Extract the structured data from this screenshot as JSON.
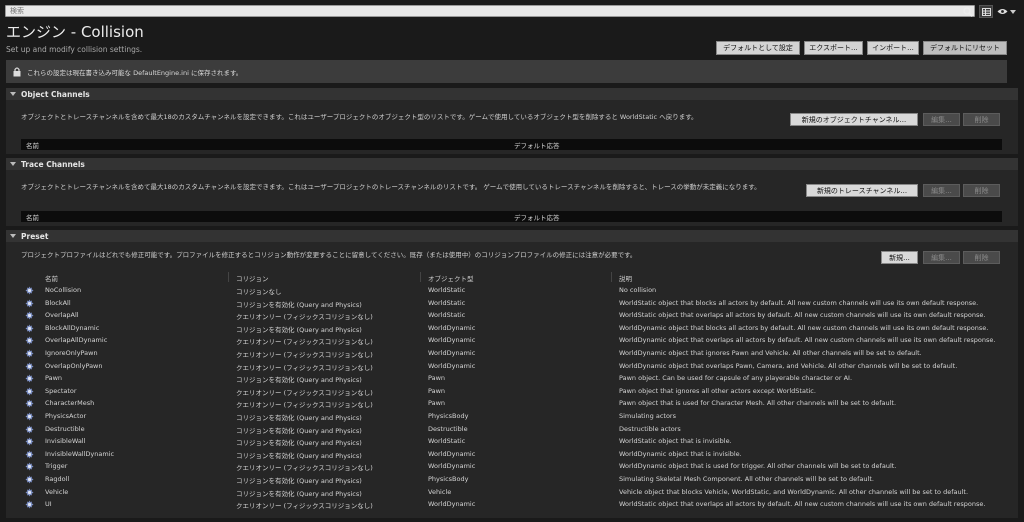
{
  "search": {
    "placeholder": "検索"
  },
  "header": {
    "title": "エンジン - Collision",
    "subtitle": "Set up and modify collision settings.",
    "buttons": {
      "set_default": "デフォルトとして設定",
      "export": "エクスポート...",
      "import": "インポート...",
      "reset": "デフォルトにリセット"
    }
  },
  "notice": {
    "text": "これらの設定は現在書き込み可能な DefaultEngine.ini に保存されます。"
  },
  "object_channels": {
    "title": "Object Channels",
    "description": "オブジェクトとトレースチャンネルを含めて最大18のカスタムチャンネルを設定できます。これはユーザープロジェクトのオブジェクト型のリストです。ゲームで使用しているオブジェクト型を削除すると WorldStatic へ戻ります。",
    "new_button": "新規のオブジェクトチャンネル...",
    "edit_button": "編集...",
    "delete_button": "削除",
    "col_name": "名前",
    "col_default": "デフォルト応答"
  },
  "trace_channels": {
    "title": "Trace Channels",
    "description": "オブジェクトとトレースチャンネルを含めて最大18のカスタムチャンネルを設定できます。これはユーザープロジェクトのトレースチャンネルのリストです。 ゲームで使用しているトレースチャンネルを削除すると、トレースの挙動が未定義になります。",
    "new_button": "新規のトレースチャンネル...",
    "edit_button": "編集...",
    "delete_button": "削除",
    "col_name": "名前",
    "col_default": "デフォルト応答"
  },
  "preset": {
    "title": "Preset",
    "description": "プロジェクトプロファイルはどれでも修正可能です。プロファイルを修正するとコリジョン動作が変更することに留意してください。既存（または使用中）のコリジョンプロファイルの修正には注意が必要です。",
    "new_button": "新規...",
    "edit_button": "編集...",
    "delete_button": "削除",
    "columns": {
      "name": "名前",
      "collision": "コリジョン",
      "object_type": "オブジェクト型",
      "description": "説明"
    },
    "rows": [
      {
        "name": "NoCollision",
        "collision": "コリジョンなし",
        "object_type": "WorldStatic",
        "description": "No collision"
      },
      {
        "name": "BlockAll",
        "collision": "コリジョンを有効化 (Query and Physics)",
        "object_type": "WorldStatic",
        "description": "WorldStatic object that blocks all actors by default. All new custom channels will use its own default response."
      },
      {
        "name": "OverlapAll",
        "collision": "クエリオンリー (フィジックスコリジョンなし)",
        "object_type": "WorldStatic",
        "description": "WorldStatic object that overlaps all actors by default. All new custom channels will use its own default response."
      },
      {
        "name": "BlockAllDynamic",
        "collision": "コリジョンを有効化 (Query and Physics)",
        "object_type": "WorldDynamic",
        "description": "WorldDynamic object that blocks all actors by default. All new custom channels will use its own default response."
      },
      {
        "name": "OverlapAllDynamic",
        "collision": "クエリオンリー (フィジックスコリジョンなし)",
        "object_type": "WorldDynamic",
        "description": "WorldDynamic object that overlaps all actors by default. All new custom channels will use its own default response."
      },
      {
        "name": "IgnoreOnlyPawn",
        "collision": "クエリオンリー (フィジックスコリジョンなし)",
        "object_type": "WorldDynamic",
        "description": "WorldDynamic object that ignores Pawn and Vehicle. All other channels will be set to default."
      },
      {
        "name": "OverlapOnlyPawn",
        "collision": "クエリオンリー (フィジックスコリジョンなし)",
        "object_type": "WorldDynamic",
        "description": "WorldDynamic object that overlaps Pawn, Camera, and Vehicle. All other channels will be set to default."
      },
      {
        "name": "Pawn",
        "collision": "コリジョンを有効化 (Query and Physics)",
        "object_type": "Pawn",
        "description": "Pawn object. Can be used for capsule of any playerable character or AI."
      },
      {
        "name": "Spectator",
        "collision": "クエリオンリー (フィジックスコリジョンなし)",
        "object_type": "Pawn",
        "description": "Pawn object that ignores all other actors except WorldStatic."
      },
      {
        "name": "CharacterMesh",
        "collision": "クエリオンリー (フィジックスコリジョンなし)",
        "object_type": "Pawn",
        "description": "Pawn object that is used for Character Mesh. All other channels will be set to default."
      },
      {
        "name": "PhysicsActor",
        "collision": "コリジョンを有効化 (Query and Physics)",
        "object_type": "PhysicsBody",
        "description": "Simulating actors"
      },
      {
        "name": "Destructible",
        "collision": "コリジョンを有効化 (Query and Physics)",
        "object_type": "Destructible",
        "description": "Destructible actors"
      },
      {
        "name": "InvisibleWall",
        "collision": "コリジョンを有効化 (Query and Physics)",
        "object_type": "WorldStatic",
        "description": "WorldStatic object that is invisible."
      },
      {
        "name": "InvisibleWallDynamic",
        "collision": "コリジョンを有効化 (Query and Physics)",
        "object_type": "WorldDynamic",
        "description": "WorldDynamic object that is invisible."
      },
      {
        "name": "Trigger",
        "collision": "クエリオンリー (フィジックスコリジョンなし)",
        "object_type": "WorldDynamic",
        "description": "WorldDynamic object that is used for trigger. All other channels will be set to default."
      },
      {
        "name": "Ragdoll",
        "collision": "コリジョンを有効化 (Query and Physics)",
        "object_type": "PhysicsBody",
        "description": "Simulating Skeletal Mesh Component. All other channels will be set to default."
      },
      {
        "name": "Vehicle",
        "collision": "コリジョンを有効化 (Query and Physics)",
        "object_type": "Vehicle",
        "description": "Vehicle object that blocks Vehicle, WorldStatic, and WorldDynamic. All other channels will be set to default."
      },
      {
        "name": "UI",
        "collision": "クエリオンリー (フィジックスコリジョンなし)",
        "object_type": "WorldDynamic",
        "description": "WorldStatic object that overlaps all actors by default. All new custom channels will use its own default response."
      }
    ]
  }
}
